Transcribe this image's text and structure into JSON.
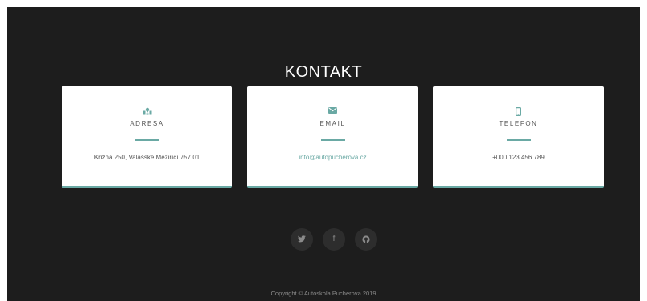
{
  "contact": {
    "heading": "KONTAKT",
    "cards": [
      {
        "icon": "map-icon",
        "label": "ADRESA",
        "value": "Křižná 250, Valašské Meziříčí 757 01"
      },
      {
        "icon": "envelope-icon",
        "label": "EMAIL",
        "value": "info@autopucherova.cz"
      },
      {
        "icon": "mobile-phone-icon",
        "label": "TELEFON",
        "value": "+000 123 456 789"
      }
    ]
  },
  "footer": {
    "social": [
      {
        "icon": "twitter-icon"
      },
      {
        "icon": "facebook-icon",
        "glyph": "f"
      },
      {
        "icon": "github-icon"
      }
    ],
    "copyright": "Copyright © Autoskola Pucherova 2019"
  },
  "colors": {
    "background": "#1d1d1d",
    "card": "#ffffff",
    "accent": "#6aa9a4",
    "social_circle": "#2d2d2d"
  }
}
